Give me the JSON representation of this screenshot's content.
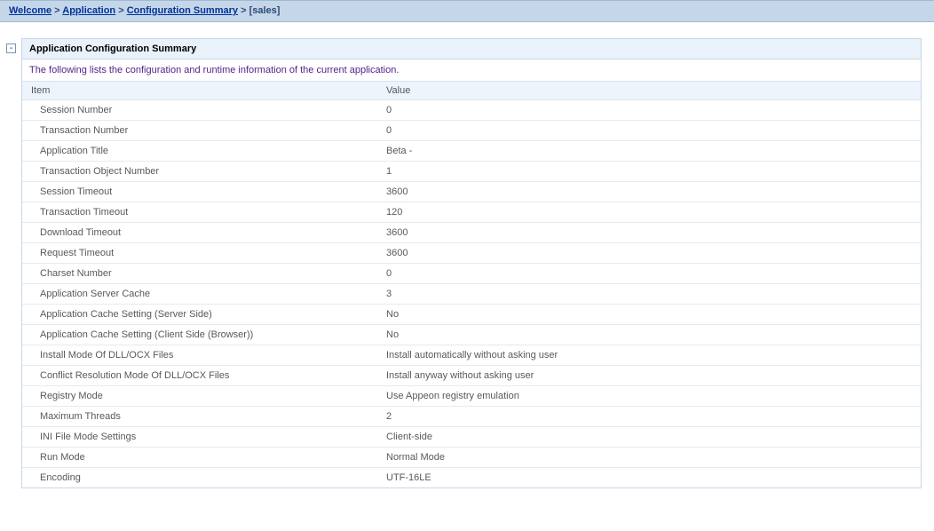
{
  "breadcrumb": {
    "items": [
      {
        "label": "Welcome",
        "link": true
      },
      {
        "label": "Application",
        "link": true
      },
      {
        "label": "Configuration Summary",
        "link": true
      },
      {
        "label": "[sales]",
        "link": false
      }
    ],
    "separator": ">"
  },
  "panel": {
    "collapse_glyph": "-",
    "title": "Application Configuration Summary",
    "description": "The following lists the configuration and runtime information of the current application.",
    "columns": {
      "item": "Item",
      "value": "Value"
    },
    "rows": [
      {
        "item": "Session Number",
        "value": "0"
      },
      {
        "item": "Transaction Number",
        "value": "0"
      },
      {
        "item": "Application Title",
        "value": "Beta -"
      },
      {
        "item": "Transaction Object Number",
        "value": "1"
      },
      {
        "item": "Session Timeout",
        "value": "3600"
      },
      {
        "item": "Transaction Timeout",
        "value": "120"
      },
      {
        "item": "Download Timeout",
        "value": "3600"
      },
      {
        "item": "Request Timeout",
        "value": "3600"
      },
      {
        "item": "Charset Number",
        "value": "0"
      },
      {
        "item": "Application Server Cache",
        "value": "3"
      },
      {
        "item": "Application Cache Setting (Server Side)",
        "value": "No"
      },
      {
        "item": "Application Cache Setting (Client Side (Browser))",
        "value": "No"
      },
      {
        "item": "Install Mode Of DLL/OCX Files",
        "value": "Install automatically without asking user"
      },
      {
        "item": "Conflict Resolution Mode Of DLL/OCX Files",
        "value": "Install anyway without asking user"
      },
      {
        "item": "Registry Mode",
        "value": "Use Appeon registry emulation"
      },
      {
        "item": "Maximum Threads",
        "value": "2"
      },
      {
        "item": "INI File Mode Settings",
        "value": "Client-side"
      },
      {
        "item": "Run Mode",
        "value": "Normal Mode"
      },
      {
        "item": "Encoding",
        "value": "UTF-16LE"
      }
    ]
  }
}
